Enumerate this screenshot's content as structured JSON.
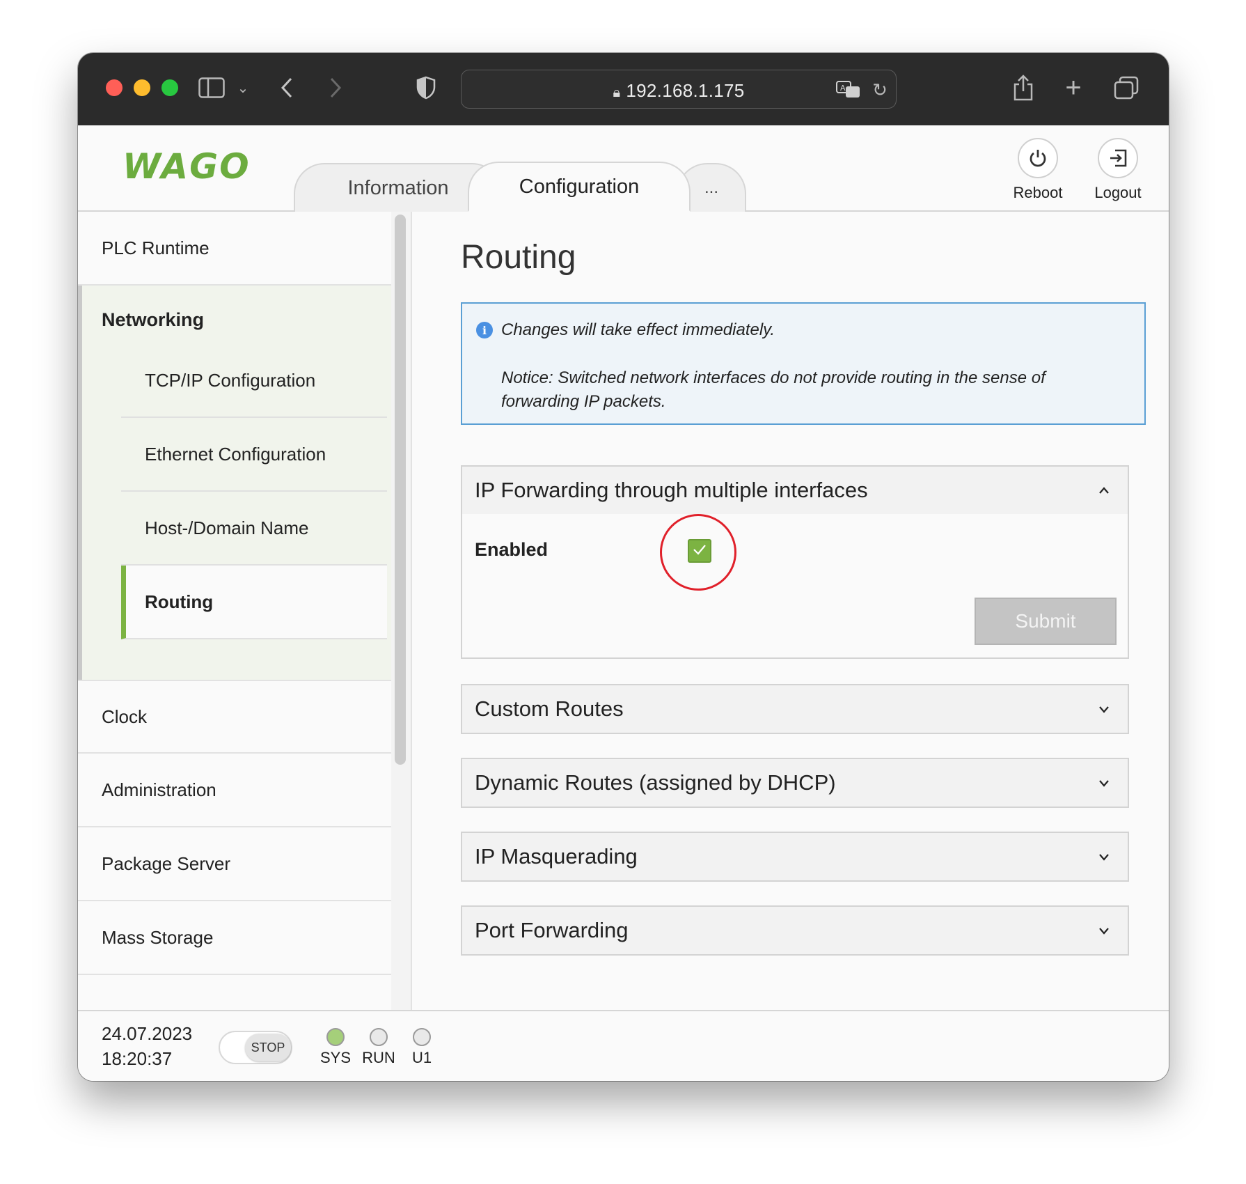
{
  "browser": {
    "address": "192.168.1.175"
  },
  "header": {
    "logo": "WAGO",
    "tabs": [
      {
        "label": "Information"
      },
      {
        "label": "Configuration"
      },
      {
        "label": "..."
      }
    ],
    "reboot_label": "Reboot",
    "logout_label": "Logout"
  },
  "sidebar": {
    "items": [
      {
        "label": "PLC Runtime"
      },
      {
        "label": "Networking"
      },
      {
        "label": "Clock"
      },
      {
        "label": "Administration"
      },
      {
        "label": "Package Server"
      },
      {
        "label": "Mass Storage"
      }
    ],
    "networking_children": [
      {
        "label": "TCP/IP Configuration"
      },
      {
        "label": "Ethernet Configuration"
      },
      {
        "label": "Host-/Domain Name"
      },
      {
        "label": "Routing"
      }
    ]
  },
  "main": {
    "title": "Routing",
    "info": {
      "line1": "Changes will take effect immediately.",
      "line2": "Notice: Switched network interfaces do not provide routing in the sense of forwarding IP packets."
    },
    "panels": [
      {
        "title": "IP Forwarding through multiple interfaces",
        "expanded": true
      },
      {
        "title": "Custom Routes",
        "expanded": false
      },
      {
        "title": "Dynamic Routes (assigned by DHCP)",
        "expanded": false
      },
      {
        "title": "IP Masquerading",
        "expanded": false
      },
      {
        "title": "Port Forwarding",
        "expanded": false
      }
    ],
    "forwarding": {
      "enabled_label": "Enabled",
      "enabled": true,
      "submit_label": "Submit"
    }
  },
  "footer": {
    "date": "24.07.2023",
    "time": "18:20:37",
    "switch_label": "STOP",
    "leds": [
      {
        "label": "SYS",
        "color": "#a5cf7a"
      },
      {
        "label": "RUN",
        "color": "#e9e9e9"
      },
      {
        "label": "U1",
        "color": "#e9e9e9"
      }
    ]
  },
  "colors": {
    "accent": "#7cb342",
    "info_border": "#5a9fd4",
    "highlight": "#e0202a"
  }
}
